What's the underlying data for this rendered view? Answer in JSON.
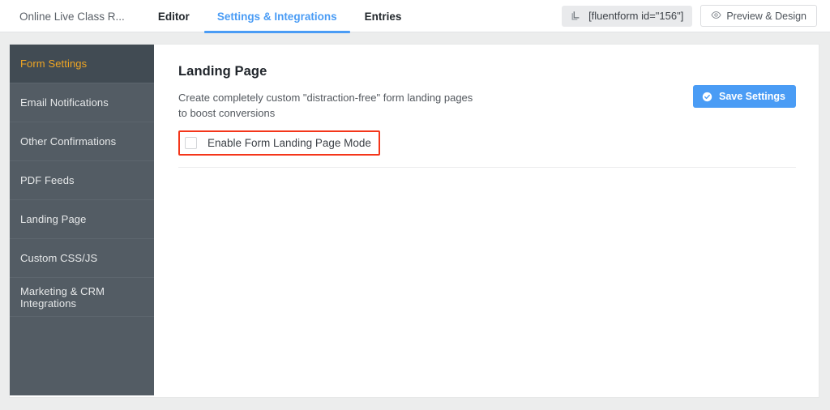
{
  "topbar": {
    "tabs": [
      {
        "label": "Online Live Class R...",
        "style": "form-title",
        "active": false
      },
      {
        "label": "Editor",
        "style": "strong",
        "active": false
      },
      {
        "label": "Settings & Integrations",
        "style": "strong",
        "active": true
      },
      {
        "label": "Entries",
        "style": "strong",
        "active": false
      }
    ],
    "shortcode": {
      "icon": "copy-icon",
      "label": "[fluentform id=\"156\"]"
    },
    "preview": {
      "icon": "eye-icon",
      "label": "Preview & Design"
    }
  },
  "sidebar": {
    "items": [
      {
        "label": "Form Settings",
        "active": true
      },
      {
        "label": "Email Notifications",
        "active": false
      },
      {
        "label": "Other Confirmations",
        "active": false
      },
      {
        "label": "PDF Feeds",
        "active": false
      },
      {
        "label": "Landing Page",
        "active": false
      },
      {
        "label": "Custom CSS/JS",
        "active": false
      },
      {
        "label": "Marketing & CRM Integrations",
        "active": false
      }
    ]
  },
  "main": {
    "title": "Landing Page",
    "description": "Create completely custom \"distraction-free\" form landing pages to boost conversions",
    "enable_checkbox": {
      "label": "Enable Form Landing Page Mode",
      "checked": false,
      "highlight_color": "#f4361a"
    },
    "save_button": {
      "icon": "check-circle-icon",
      "label": "Save Settings"
    }
  },
  "colors": {
    "accent_blue": "#4a9cf5",
    "sidebar_bg": "#535c64",
    "sidebar_active_bg": "#414b53",
    "sidebar_active_text": "#f0a623",
    "page_bg": "#eceded",
    "annotation_red": "#f4361a"
  }
}
